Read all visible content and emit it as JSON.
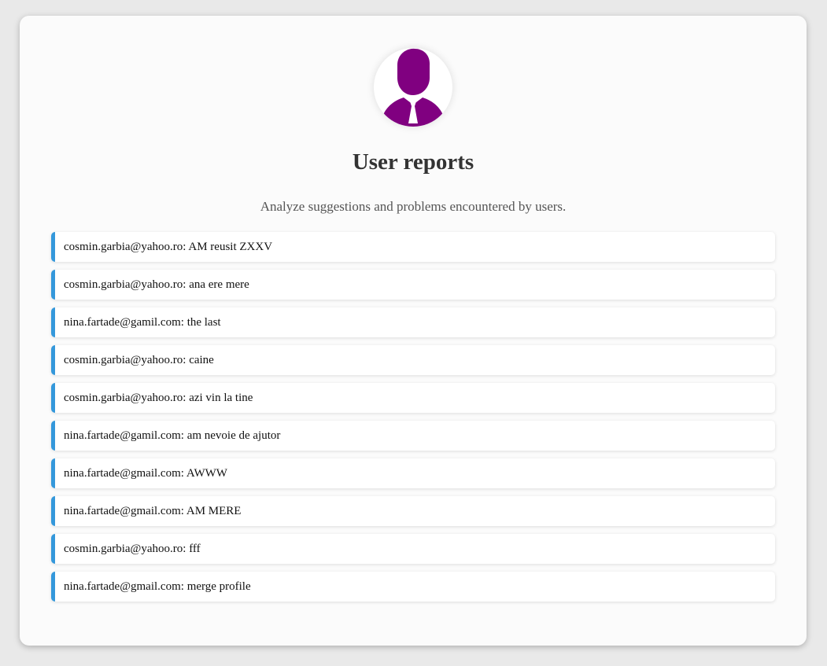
{
  "header": {
    "avatar_icon": "user-silhouette-icon",
    "avatar_color": "#800080",
    "title": "User reports",
    "subtitle": "Analyze suggestions and problems encountered by users."
  },
  "accent_color": "#3498db",
  "reports": [
    {
      "email": "cosmin.garbia@yahoo.ro",
      "message": "AM reusit ZXXV"
    },
    {
      "email": "cosmin.garbia@yahoo.ro",
      "message": "ana ere mere"
    },
    {
      "email": "nina.fartade@gamil.com",
      "message": "the last"
    },
    {
      "email": "cosmin.garbia@yahoo.ro",
      "message": "caine"
    },
    {
      "email": "cosmin.garbia@yahoo.ro",
      "message": "azi vin la tine"
    },
    {
      "email": "nina.fartade@gamil.com",
      "message": "am nevoie de ajutor"
    },
    {
      "email": "nina.fartade@gmail.com",
      "message": "AWWW"
    },
    {
      "email": "nina.fartade@gmail.com",
      "message": "AM MERE"
    },
    {
      "email": "cosmin.garbia@yahoo.ro",
      "message": "fff"
    },
    {
      "email": "nina.fartade@gmail.com",
      "message": "merge profile"
    }
  ]
}
